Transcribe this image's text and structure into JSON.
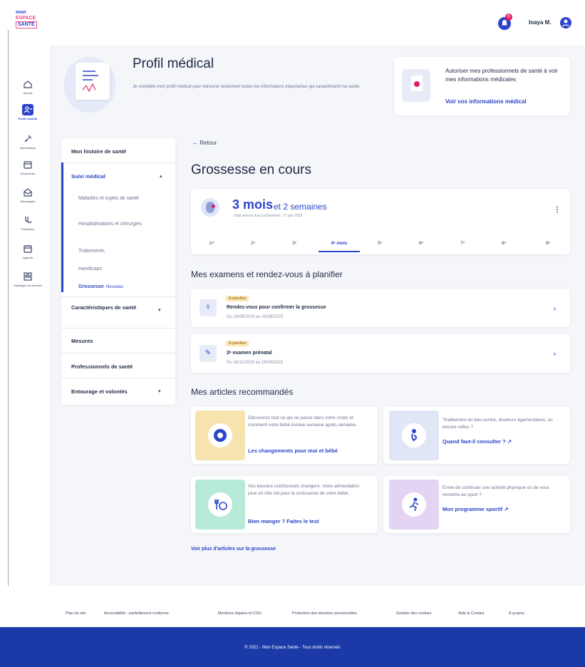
{
  "app": {
    "logo_line1": "mon",
    "logo_line2": "ESPACE",
    "logo_line3": "SANTÉ"
  },
  "topbar": {
    "notif_count": "6",
    "user_name": "Inaya M."
  },
  "rail": [
    {
      "label": "Accueil",
      "icon": "home-icon"
    },
    {
      "label": "Profil médical",
      "icon": "profile-icon",
      "active": true
    },
    {
      "label": "Vaccinations",
      "icon": "syringe-icon"
    },
    {
      "label": "Documents",
      "icon": "folder-icon"
    },
    {
      "label": "Messagerie",
      "icon": "mail-icon"
    },
    {
      "label": "Prévention",
      "icon": "prevention-icon"
    },
    {
      "label": "Agenda",
      "icon": "calendar-icon"
    },
    {
      "label": "Catalogue de services",
      "icon": "catalog-icon"
    }
  ],
  "header": {
    "title": "Profil médical",
    "subtitle": "Je complète mon profil médical pour retrouver facilement toutes les informations importantes qui caractérisent ma santé."
  },
  "auth_card": {
    "text": "Autoriser mes professionnels de santé à voir mes informations médicales",
    "link": "Voir vos informations médical"
  },
  "subnav": {
    "history": "Mon histoire de santé",
    "suivi": "Suivi médical",
    "sub_items": [
      "Maladies et sujets de santé",
      "Hospitalisations et chirurgies",
      "Traitements",
      "Handicaps"
    ],
    "active_sub": "Grossesse",
    "active_badge": "Nouveau",
    "caract": "Caractéristiques de santé",
    "mesures": "Mesures",
    "pros": "Professionnels de santé",
    "entourage": "Entourage et volontés"
  },
  "content": {
    "back": "← Retour",
    "title": "Grossesse en cours",
    "months": "3 mois",
    "weeks": "et 2 semaines",
    "due_date": "Date prévue d'accouchement : 17 juin 2025",
    "month_tabs": [
      "1ᵉʳ",
      "2ᵉ",
      "3ᵉ",
      "4ᵉ mois",
      "5ᵉ",
      "6ᵉ",
      "7ᵉ",
      "8ᵉ",
      "9ᵉ"
    ],
    "exams_title": "Mes examens et rendez-vous à planifier",
    "exams": [
      {
        "badge": "À planifier",
        "title": "Rendez-vous pour confirmer la grossesse",
        "date": "Du 16/09/2024 au 16/06/2025",
        "icon": "stethoscope-icon"
      },
      {
        "badge": "À planifier",
        "title": "2ᵉ examen prénatal",
        "date": "Du 16/11/2024 au 16/06/2025",
        "icon": "probe-icon"
      }
    ],
    "articles_title": "Mes articles recommandés",
    "articles": [
      {
        "text": "Découvrez tout ce qui se passe dans votre corps et comment votre bébé évolue semaine après semaine.",
        "link": "Les changements pour moi et bébé",
        "color": "#f7e3ae",
        "icon": "baby-icon"
      },
      {
        "text": "Tiraillement du bas-ventre, douleurs ligamentaires, ou encore reflux ?",
        "link": "Quand faut-il consulter ? ↗",
        "color": "#e1e6f7",
        "icon": "pregnant-icon"
      },
      {
        "text": "Vos besoins nutritionnels changent. Votre alimentation joue un rôle clé pour la croissance de votre bébé.",
        "link": "Bien manger ? Faites le test",
        "color": "#b7ead8",
        "icon": "food-icon"
      },
      {
        "text": "Envie de continuer une activité physique ou de vous remettre au sport ?",
        "link": "Mon programme sportif ↗",
        "color": "#e3d4f3",
        "icon": "sport-icon"
      }
    ],
    "see_more": "Voir plus d'articles sur la grossesse"
  },
  "footer": {
    "links": [
      "Plan du site",
      "Accessibilité : partiellement conforme",
      "Mentions légales et CGU",
      "Protection des données personnelles",
      "Gestion des cookies",
      "Aide & Contact",
      "À propos"
    ],
    "copyright": "© 2021 - Mon Espace Santé - Tous droits réservés"
  }
}
